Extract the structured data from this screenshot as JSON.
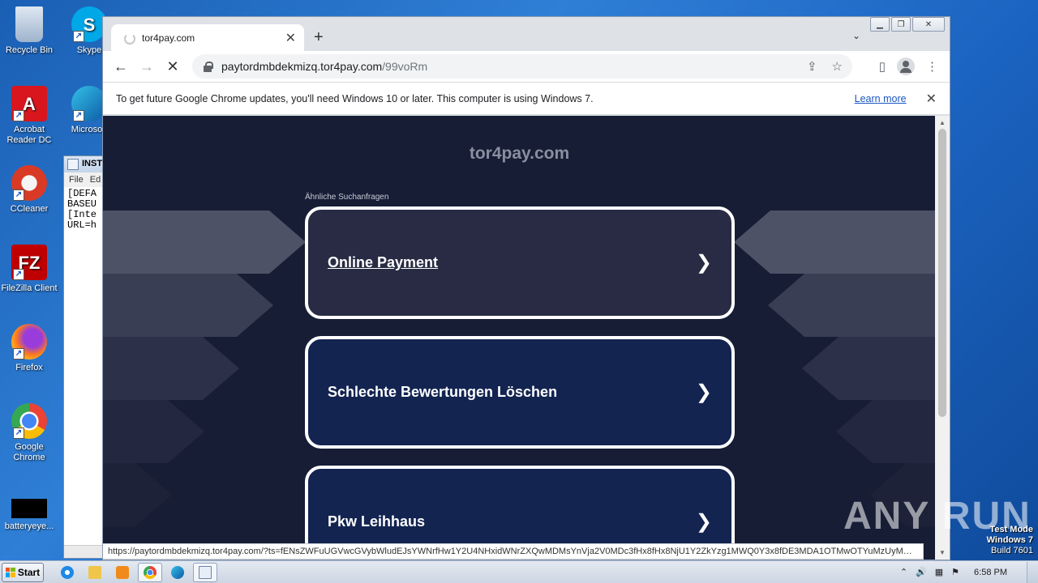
{
  "desktop": {
    "icons": [
      {
        "label": "Recycle Bin"
      },
      {
        "label": "Skype"
      },
      {
        "label": "Acrobat Reader DC"
      },
      {
        "label": "Microsoft"
      },
      {
        "label": "CCleaner"
      },
      {
        "label": "FileZilla Client"
      },
      {
        "label": "Firefox"
      },
      {
        "label": "Google Chrome"
      },
      {
        "label": "batteryeye..."
      }
    ]
  },
  "notepad": {
    "title": "INST",
    "menu": [
      "File",
      "Ed"
    ],
    "lines": [
      "[DEFA",
      "BASEU",
      "[Inte",
      "URL=h"
    ]
  },
  "browser": {
    "tab_title": "tor4pay.com",
    "url_host": "paytordmbdekmizq.tor4pay.com",
    "url_path": "/99voRm",
    "infobar_text": "To get future Google Chrome updates, you'll need Windows 10 or later. This computer is using Windows 7.",
    "infobar_link": "Learn more",
    "status_url": "https://paytordmbdekmizq.tor4pay.com/?ts=fENsZWFuUGVwcGVybWludEJsYWNrfHw1Y2U4NHxidWNrZXQwMDMsYnVja2V0MDc3fHx8fHx8NjU1Y2ZkYzg1MWQ0Y3x8fDE3MDA1OTMwOTYuMzUyMXwxNjlmM2U..."
  },
  "page": {
    "site_title": "tor4pay.com",
    "related_heading": "Ähnliche Suchanfragen",
    "links": [
      {
        "label": "Online Payment"
      },
      {
        "label": "Schlechte Bewertungen Löschen"
      },
      {
        "label": "Pkw Leihhaus"
      }
    ]
  },
  "watermark": "ANY RUN",
  "system": {
    "testmode_line1": "Test Mode",
    "testmode_line2": "Windows 7",
    "testmode_line3": "Build 7601",
    "start_label": "Start",
    "clock": "6:58 PM"
  }
}
